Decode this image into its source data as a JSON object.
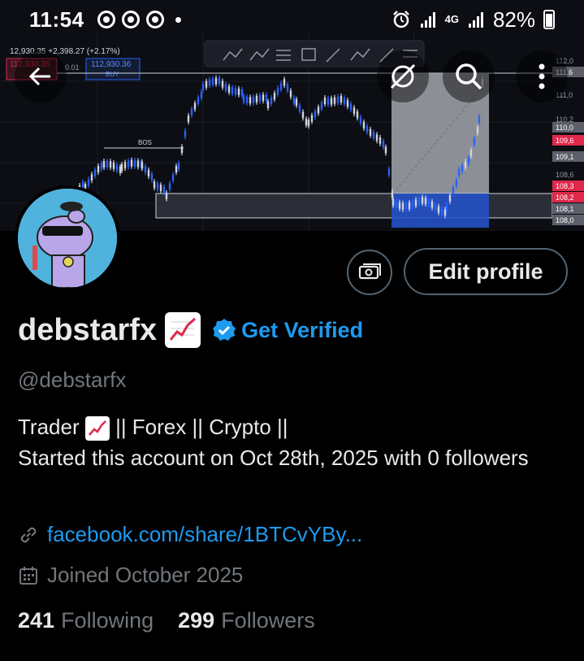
{
  "status_bar": {
    "time": "11:54",
    "network": "4G",
    "battery": "82%"
  },
  "banner": {
    "price_top": "12,930.35 +2,398.27 (+2.17%)",
    "sell_price": "112,930.35",
    "spread": "0.01",
    "buy_price": "112,930.36",
    "buy_label": "BUY",
    "bos_label": "BOS",
    "axis_ticks": [
      "112,0",
      "111,6",
      "111,0",
      "110,2",
      "110,0",
      "109,6",
      "109,1",
      "108,6",
      "108,3",
      "108,2",
      "108,1",
      "108,0"
    ],
    "tag_colors": {
      "red": "#e0284a",
      "gray": "#5d606b",
      "blue": "#2962ff"
    }
  },
  "profile": {
    "display_name": "debstarfx",
    "verify_label": "Get Verified",
    "handle": "@debstarfx",
    "bio_line1_pre": "Trader ",
    "bio_line1_post": " || Forex || Crypto ||",
    "bio_line2": "Started this account on Oct 28th, 2025 with 0 followers",
    "link": "facebook.com/share/1BTCvYBy...",
    "joined": "Joined October 2025",
    "following_count": "241",
    "following_label": "Following",
    "followers_count": "299",
    "followers_label": "Followers"
  },
  "buttons": {
    "edit_profile": "Edit profile"
  },
  "colors": {
    "accent": "#1d9bf0",
    "muted": "#71767b",
    "border": "#536471"
  },
  "icons": [
    "back-arrow-icon",
    "grok-icon",
    "search-icon",
    "more-icon",
    "money-icon",
    "chart-emoji-icon",
    "verified-badge-icon",
    "link-icon",
    "calendar-icon"
  ]
}
